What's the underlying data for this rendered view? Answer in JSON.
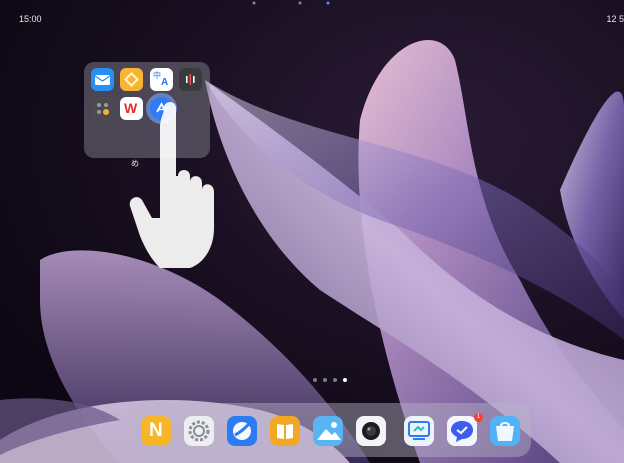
{
  "status_bar": {
    "time": "15:00",
    "right_text": "12 5"
  },
  "folder": {
    "label": "め",
    "apps": [
      {
        "name": "mail-icon",
        "color": "#2b8ef3"
      },
      {
        "name": "origami-icon",
        "color": "#f7b533"
      },
      {
        "name": "translate-icon",
        "color": "#ffffff",
        "text_top": "中",
        "text_bottom": "A"
      },
      {
        "name": "voice-recorder-icon",
        "color": "#3a3a3f"
      },
      {
        "name": "calculator-icon",
        "color": "#4a4a50"
      },
      {
        "name": "wps-office-icon",
        "color": "#ffffff",
        "text": "W"
      },
      {
        "name": "app-store-icon",
        "color": "#2f7cf6"
      }
    ]
  },
  "page_indicator": {
    "count": 4,
    "active": 3
  },
  "dock": {
    "apps": [
      {
        "name": "notes-icon",
        "color": "#f6b52b",
        "text": "N"
      },
      {
        "name": "settings-icon",
        "color": "#eceef2"
      },
      {
        "name": "browser-icon",
        "color": "#2b7cf2"
      },
      {
        "name": "books-icon",
        "color": "#f2a726"
      },
      {
        "name": "gallery-icon",
        "color": "#56b5f2"
      },
      {
        "name": "camera-icon",
        "color": "#f4f4f6"
      },
      {
        "name": "screen-mirror-icon",
        "color": "#eef3fb"
      },
      {
        "name": "messages-icon",
        "color": "#f4f6ff"
      },
      {
        "name": "shopping-bag-icon",
        "color": "#4fb3f6"
      }
    ],
    "badge": "1"
  }
}
